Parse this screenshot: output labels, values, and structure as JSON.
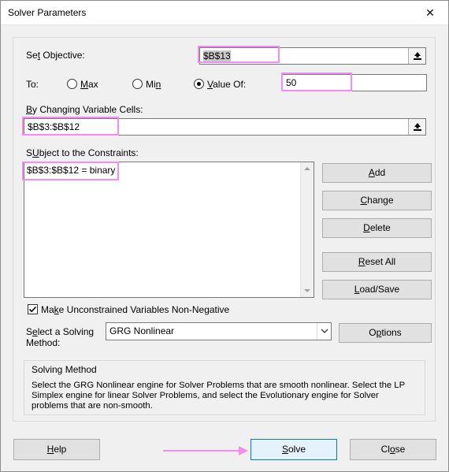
{
  "window": {
    "title": "Solver Parameters",
    "close_glyph": "✕"
  },
  "objective": {
    "label_u": "t",
    "label_pre": "Se",
    "label_post": " Objective:",
    "value": "$B$13"
  },
  "to": {
    "label": "To:",
    "max": {
      "u": "M",
      "rest": "ax",
      "selected": false
    },
    "min": {
      "pre": "Mi",
      "u": "n",
      "selected": false
    },
    "value_of": {
      "u": "V",
      "rest": "alue Of:",
      "selected": true
    },
    "value": "50"
  },
  "changing": {
    "label_u": "B",
    "label_rest": "y Changing Variable Cells:",
    "value": "$B$3:$B$12"
  },
  "constraints": {
    "label_u": "U",
    "label_pre": "S",
    "label_post": "bject to the Constraints:",
    "items": [
      "$B$3:$B$12 = binary"
    ]
  },
  "buttons": {
    "add": {
      "u": "A",
      "rest": "dd"
    },
    "change": {
      "u": "C",
      "rest": "hange"
    },
    "delete": {
      "u": "D",
      "rest": "elete"
    },
    "reset": {
      "u": "R",
      "rest": "eset All"
    },
    "load": {
      "u": "L",
      "rest": "oad/Save"
    },
    "options": {
      "pre": "O",
      "u": "p",
      "rest": "tions"
    },
    "help": {
      "u": "H",
      "rest": "elp"
    },
    "solve": {
      "u": "S",
      "rest": "olve"
    },
    "close": {
      "pre": "Cl",
      "u": "o",
      "rest": "se"
    }
  },
  "unconstrained": {
    "checked": true,
    "u": "k",
    "pre": "Ma",
    "rest": "e Unconstrained Variables Non-Negative"
  },
  "method": {
    "label_pre": "S",
    "label_u": "e",
    "label_post": "lect a Solving",
    "label_line2": "Method:",
    "selected": "GRG Nonlinear"
  },
  "solving_method": {
    "title": "Solving Method",
    "description_lines": [
      "Select the GRG Nonlinear engine for Solver Problems that are smooth nonlinear. Select the LP",
      "Simplex engine for linear Solver Problems, and select the Evolutionary engine for Solver",
      "problems that are non-smooth."
    ]
  },
  "colors": {
    "highlight": "#f58cf2",
    "solve_button_bg": "#e5f1fb",
    "solve_button_border": "#0078d7"
  },
  "icons": {
    "ref": "collapse-dialog-icon",
    "check": "check-icon",
    "arrow": "pointer-arrow"
  }
}
